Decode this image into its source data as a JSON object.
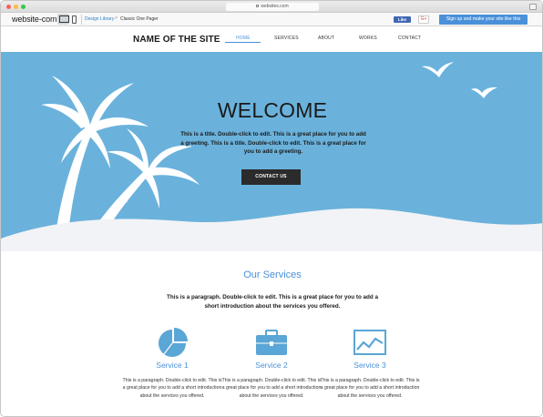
{
  "browser": {
    "url": "websites.com"
  },
  "toolbar": {
    "logo": "website-com",
    "breadcrumb": [
      "Design Library",
      "Classic One Pager"
    ],
    "breadcrumb_separator": ">",
    "like_label": "Like",
    "gplus_label": "G+",
    "signup_label": "Sign up and make your site like this"
  },
  "site": {
    "name": "NAME OF THE SITE",
    "nav": [
      "HOME",
      "SERVICES",
      "ABOUT",
      "WORKS",
      "CONTACT"
    ],
    "active_nav": "HOME"
  },
  "hero": {
    "title": "WELCOME",
    "text": "This is a title. Double-click to edit. This is a great place for you to add a greeting. This is a title. Double-click to edit. This is a great place for you to add a greeting.",
    "button": "CONTACT US"
  },
  "services": {
    "title": "Our Services",
    "intro": "This is a paragraph. Double-click to edit. This is a great place for you to add a short introduction about the services you offered.",
    "items": [
      {
        "name": "Service 1",
        "icon": "pie-chart-icon",
        "description": "This is a paragraph. Double-click to edit. This is a great place for you to add a short introduction about the services you offered."
      },
      {
        "name": "Service 2",
        "icon": "briefcase-icon",
        "description": "This is a paragraph. Double-click to edit. This is a great place for you to add a short introduction about the services you offered."
      },
      {
        "name": "Service 3",
        "icon": "line-chart-icon",
        "description": "This is a paragraph. Double-click to edit. This is a great place for you to add a short introduction about the services you offered."
      }
    ]
  },
  "colors": {
    "accent": "#4a90d9",
    "hero_bg": "#6ab2dc",
    "button_dark": "#2b2b2b"
  }
}
